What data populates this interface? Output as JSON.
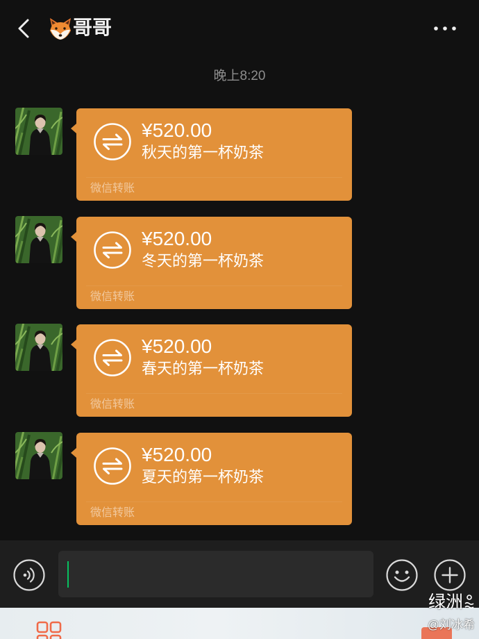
{
  "header": {
    "title": "哥哥",
    "back_icon": "chevron-left-icon",
    "title_icon": "fox-emoji-icon",
    "more_icon": "more-dots-icon"
  },
  "timestamp": "晚上8:20",
  "messages": [
    {
      "amount": "¥520.00",
      "note": "秋天的第一杯奶茶",
      "label": "微信转账",
      "icon": "transfer-icon"
    },
    {
      "amount": "¥520.00",
      "note": "冬天的第一杯奶茶",
      "label": "微信转账",
      "icon": "transfer-icon"
    },
    {
      "amount": "¥520.00",
      "note": "春天的第一杯奶茶",
      "label": "微信转账",
      "icon": "transfer-icon"
    },
    {
      "amount": "¥520.00",
      "note": "夏天的第一杯奶茶",
      "label": "微信转账",
      "icon": "transfer-icon"
    }
  ],
  "input_bar": {
    "text_value": "",
    "voice_icon": "voice-icon",
    "emoji_icon": "emoji-icon",
    "plus_icon": "plus-icon"
  },
  "watermark": {
    "app": "绿洲",
    "handle": "@刘冰希"
  },
  "colors": {
    "background": "#111111",
    "transfer_bubble": "#E2913A",
    "input_bar": "#1E1E1E",
    "input_field": "#2B2B2B",
    "cursor": "#07C160",
    "timestamp_text": "#8E8E8E"
  }
}
